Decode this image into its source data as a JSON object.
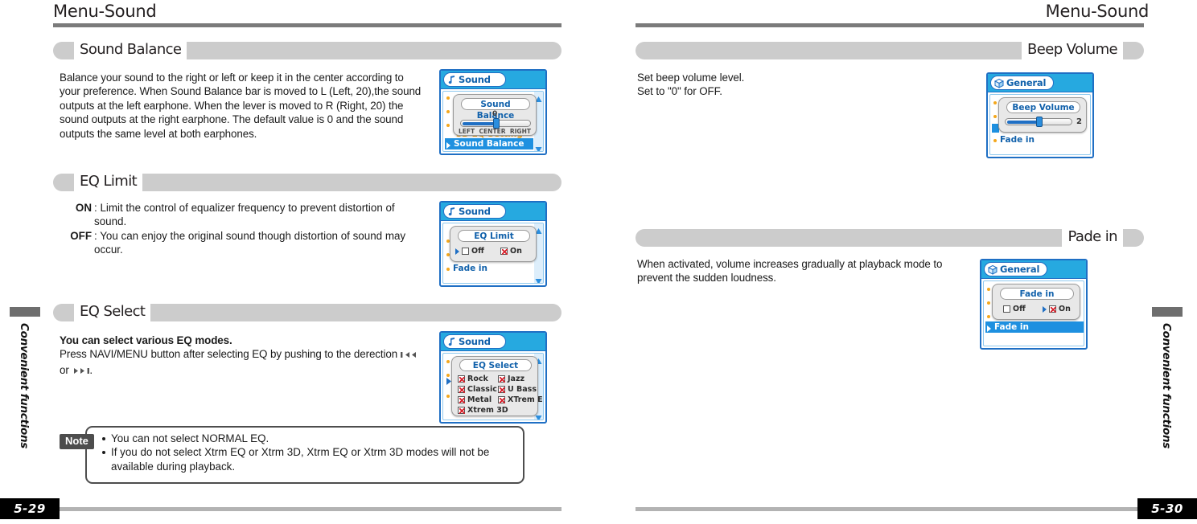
{
  "left_page": {
    "running_head": "Menu-Sound",
    "side_tab_label": "Convenient functions",
    "folio": "5-29",
    "sections": [
      {
        "title": "Sound Balance",
        "body": "Balance your sound to the right or left or keep it in the center according to your preference. When Sound Balance bar is moved to L (Left, 20),the sound outputs at the left earphone.  When the lever is moved to R (Right, 20) the sound outputs at the right earphone. The default value is 0 and the sound outputs the same level at both earphones.",
        "device": {
          "title": "Sound",
          "icon": "music-note-icon",
          "popup_title": "Sound Balance",
          "value": "0",
          "scale_left": "LEFT",
          "scale_center": "CENTER",
          "scale_right": "RIGHT",
          "ghost_row": "3D EQ Setting",
          "selected_row": "Sound Balance"
        }
      },
      {
        "title": "EQ Limit",
        "definitions": [
          {
            "term": "ON",
            "text": ": Limit the control of equalizer frequency to prevent distortion of sound."
          },
          {
            "term": "OFF",
            "text": ": You can enjoy the original sound though distortion of sound may occur."
          }
        ],
        "device": {
          "title": "Sound",
          "icon": "music-note-icon",
          "popup_title": "EQ Limit",
          "options": [
            {
              "label": "Off",
              "checked": false,
              "cursor": true
            },
            {
              "label": "On",
              "checked": true,
              "cursor": false
            }
          ],
          "row_label": "Fade in"
        }
      },
      {
        "title": "EQ Select",
        "lead": "You can select various EQ modes.",
        "body": "Press NAVI/MENU button after selecting EQ by pushing to the derection",
        "body_tail": ".",
        "body_or": "or",
        "device": {
          "title": "Sound",
          "icon": "music-note-icon",
          "popup_title": "EQ Select",
          "modes": [
            {
              "label": "Rock",
              "checked": true
            },
            {
              "label": "Jazz",
              "checked": true
            },
            {
              "label": "Classic",
              "checked": true
            },
            {
              "label": "U Bass",
              "checked": true
            },
            {
              "label": "Metal",
              "checked": true
            },
            {
              "label": "XTrem EQ",
              "checked": true
            },
            {
              "label": "Xtrem 3D",
              "checked": true
            }
          ]
        }
      }
    ],
    "note": {
      "tag": "Note",
      "items": [
        "You can not select NORMAL EQ.",
        "If you do not select Xtrm EQ or Xtrm 3D, Xtrm EQ or Xtrm 3D modes will not be available during playback."
      ]
    }
  },
  "right_page": {
    "running_head": "Menu-Sound",
    "side_tab_label": "Convenient functions",
    "folio": "5-30",
    "sections": [
      {
        "title": "Beep Volume",
        "body_line1": "Set beep volume level.",
        "body_line2": "Set to \"0\" for OFF.",
        "device": {
          "title": "General",
          "icon": "cube-icon",
          "popup_title": "Beep Volume",
          "value": "2",
          "row_label": "Fade in"
        }
      },
      {
        "title": "Pade in",
        "body": "When activated, volume increases gradually at playback mode to prevent the sudden loudness.",
        "device": {
          "title": "General",
          "icon": "cube-icon",
          "popup_title": "Fade in",
          "options": [
            {
              "label": "Off",
              "checked": false,
              "cursor": false
            },
            {
              "label": "On",
              "checked": true,
              "cursor": true
            }
          ],
          "selected_row": "Fade in"
        }
      }
    ]
  },
  "colors": {
    "accent_blue": "#1f6fc4",
    "title_cyan": "#26a9e0",
    "bar_gray": "#cccccc",
    "rule_gray": "#7b7b7b",
    "check_red": "#d81f2a",
    "bullet_orange": "#f4a81d"
  }
}
